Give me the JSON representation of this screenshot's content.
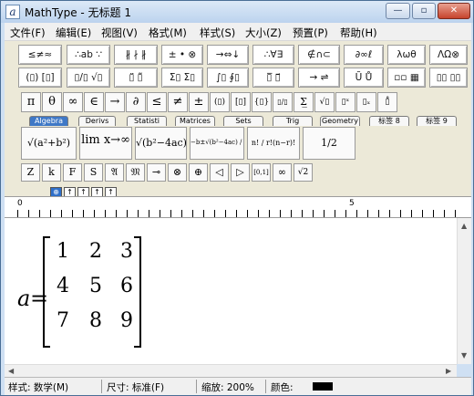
{
  "window": {
    "app_icon": "a",
    "title": "MathType - 无标题 1",
    "min_glyph": "—",
    "max_glyph": "▫",
    "close_glyph": "✕"
  },
  "menu": [
    "文件(F)",
    "编辑(E)",
    "视图(V)",
    "格式(M)",
    "样式(S)",
    "大小(Z)",
    "预置(P)",
    "帮助(H)"
  ],
  "palettes_row1": [
    "≤≠≈",
    "∴ab ∵",
    "∦ ∤ ∦",
    "± • ⊗",
    "→⇔↓",
    "∴∀∃",
    "∉∩⊂",
    "∂∞ℓ",
    "λωθ",
    "ΛΩ⊗"
  ],
  "palettes_row2": [
    "(▯) [▯]",
    "▯/▯ √▯",
    "▯̈ ▯̃",
    "Σ▯ Σ▯",
    "∫▯ ∮▯",
    "▯̅ ▯⃗",
    "→ ⇌",
    "Ũ Ů",
    "▫▫ ▦",
    "▯▯ ▯▯"
  ],
  "symbols": [
    "π",
    "θ",
    "∞",
    "∈",
    "→",
    "∂",
    "≤",
    "≠",
    "±",
    "(▯)",
    "[▯]",
    "{▯}",
    "▯/▯",
    "Σ̲",
    "√▯",
    "▯ˣ",
    "▯ₓ",
    "▯̊"
  ],
  "tabs": [
    "Algebra",
    "Derivs",
    "Statisti",
    "Matrices",
    "Sets",
    "Trig",
    "Geometry",
    "标签 8",
    "标签 9"
  ],
  "templates": [
    "√(a²+b²)",
    "lim x→∞",
    "√(b²−4ac)",
    "−b±√(b²−4ac) / 2a",
    "n! / r!(n−r)!",
    "1/2"
  ],
  "small_symbols": [
    "Z",
    "k",
    "F",
    "S",
    "𝔄",
    "𝔐",
    "⊸",
    "⊗",
    "⊕",
    "◁",
    "▷",
    "[0,1]",
    "∞",
    "√2"
  ],
  "align_buttons": [
    "⊕",
    "↑",
    "↑",
    "↑",
    "↑"
  ],
  "ruler": {
    "start": "0",
    "mid": "5"
  },
  "equation": {
    "variable": "a",
    "equals": "=",
    "matrix": [
      [
        "1",
        "2",
        "3"
      ],
      [
        "4",
        "5",
        "6"
      ],
      [
        "7",
        "8",
        "9"
      ]
    ]
  },
  "statusbar": {
    "style": "样式: 数学(M)",
    "size": "尺寸: 标准(F)",
    "zoom": "缩放: 200%",
    "color_label": "颜色:",
    "color": "#000000"
  }
}
